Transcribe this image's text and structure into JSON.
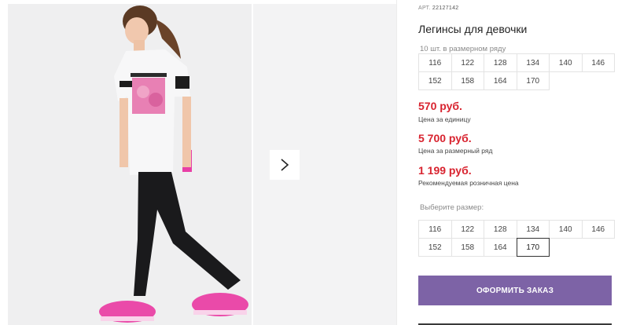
{
  "product": {
    "art_label": "АРТ.",
    "art_number": "22127142",
    "title": "Легинсы для девочки",
    "pack_hint": "10 шт. в размерном ряду",
    "pack_sizes": [
      "116",
      "122",
      "128",
      "134",
      "140",
      "146",
      "152",
      "158",
      "164",
      "170"
    ],
    "prices": [
      {
        "value": "570 руб.",
        "label": "Цена за единицу"
      },
      {
        "value": "5 700 руб.",
        "label": "Цена за размерный ряд"
      },
      {
        "value": "1 199 руб.",
        "label": "Рекомендуемая розничная цена"
      }
    ],
    "choose_label": "Выберите размер:",
    "choose_sizes": [
      "116",
      "122",
      "128",
      "134",
      "140",
      "146",
      "152",
      "158",
      "164",
      "170"
    ],
    "selected_size": "170",
    "order_button": "ОФОРМИТЬ ЗАКАЗ"
  },
  "gallery": {
    "next_icon": "chevron-right-icon"
  },
  "colors": {
    "price": "#d8232f",
    "button": "#7d63a6",
    "accent_pink": "#e83fa6"
  }
}
